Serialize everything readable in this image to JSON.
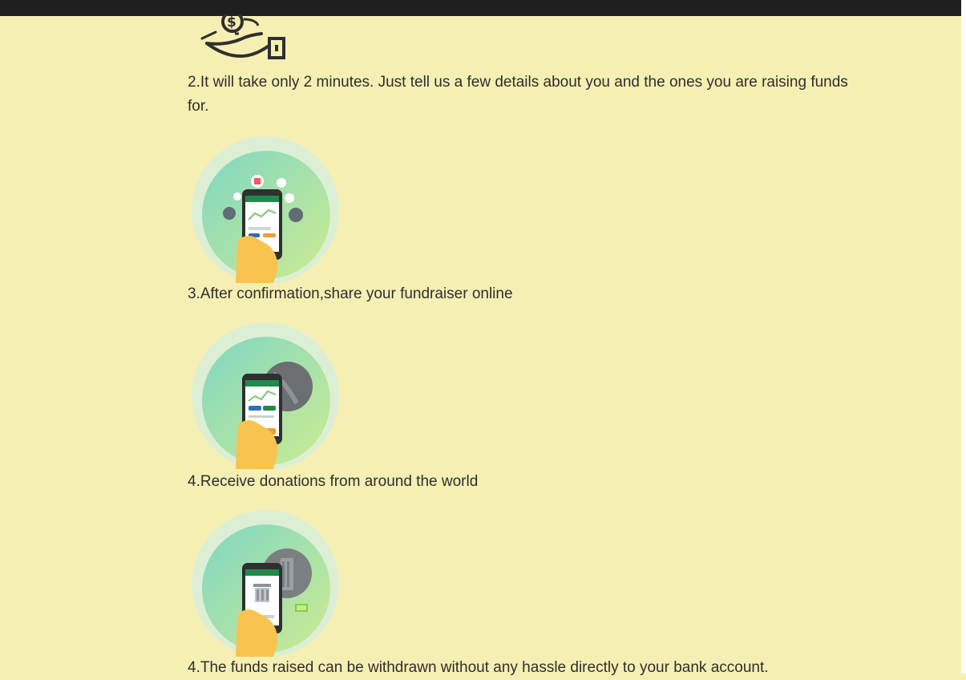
{
  "steps": [
    {
      "text": "2.It will take only 2 minutes. Just tell us a few details about you and the ones you are raising funds for.",
      "icon": "hand-coin-icon"
    },
    {
      "text": "3.After confirmation,share your fundraiser online",
      "icon": "share-phone-icon"
    },
    {
      "text": "4.Receive donations from around the world",
      "icon": "donation-phone-icon"
    },
    {
      "text": "4.The funds raised can be withdrawn without any hassle directly to your bank account.",
      "icon": "bank-phone-icon"
    }
  ],
  "colors": {
    "background": "#f6efb3",
    "topbar": "#1f1f1f",
    "text": "#2e2e2e",
    "green": "#1f8a4c",
    "teal": "#7fd3c2",
    "lightGreen": "#b8e39a",
    "hand": "#f8c34f"
  }
}
